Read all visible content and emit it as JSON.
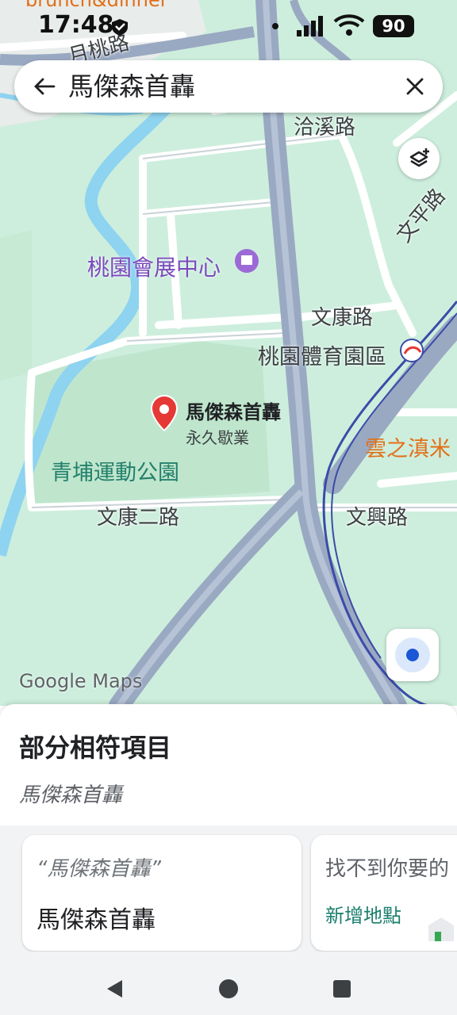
{
  "status_bar": {
    "time": "17:48",
    "battery": "90",
    "cut_off_text": "brunch&dinner"
  },
  "search": {
    "query": "馬傑森首轟",
    "back_icon": "arrow-left-icon",
    "clear_icon": "close-icon"
  },
  "map": {
    "labels": {
      "yuetao_rd": "月桃路",
      "qiaxi_rd": "洽溪路",
      "wenping_rd": "文平路",
      "convention_center": "桃園會展中心",
      "wenkang_rd": "文康路",
      "sports_park": "桃園體育園區",
      "wenkang_2nd_rd": "文康二路",
      "wenxing_rd": "文興路",
      "qingpu_park": "青埔運動公園",
      "yunzhidian": "雲之滇米",
      "google_maps": "Google Maps"
    },
    "pin": {
      "title": "馬傑森首轟",
      "subtitle": "永久歇業"
    },
    "colors": {
      "land": "#cdeedd",
      "park": "#bfe6cd",
      "road": "#ffffff",
      "highway": "#9aa9c2",
      "water": "#8ed3f0",
      "rail": "#3b4ba8",
      "pin": "#e53935"
    }
  },
  "sheet": {
    "title": "部分相符項目",
    "subtitle": "馬傑森首轟",
    "card_quote": "“馬傑森首轟”",
    "card_name": "馬傑森首轟",
    "card2_question": "找不到你要的",
    "card2_add": "新增地點"
  },
  "nav": {
    "back_icon": "triangle-back-icon",
    "home_icon": "circle-home-icon",
    "recents_icon": "square-recents-icon"
  }
}
